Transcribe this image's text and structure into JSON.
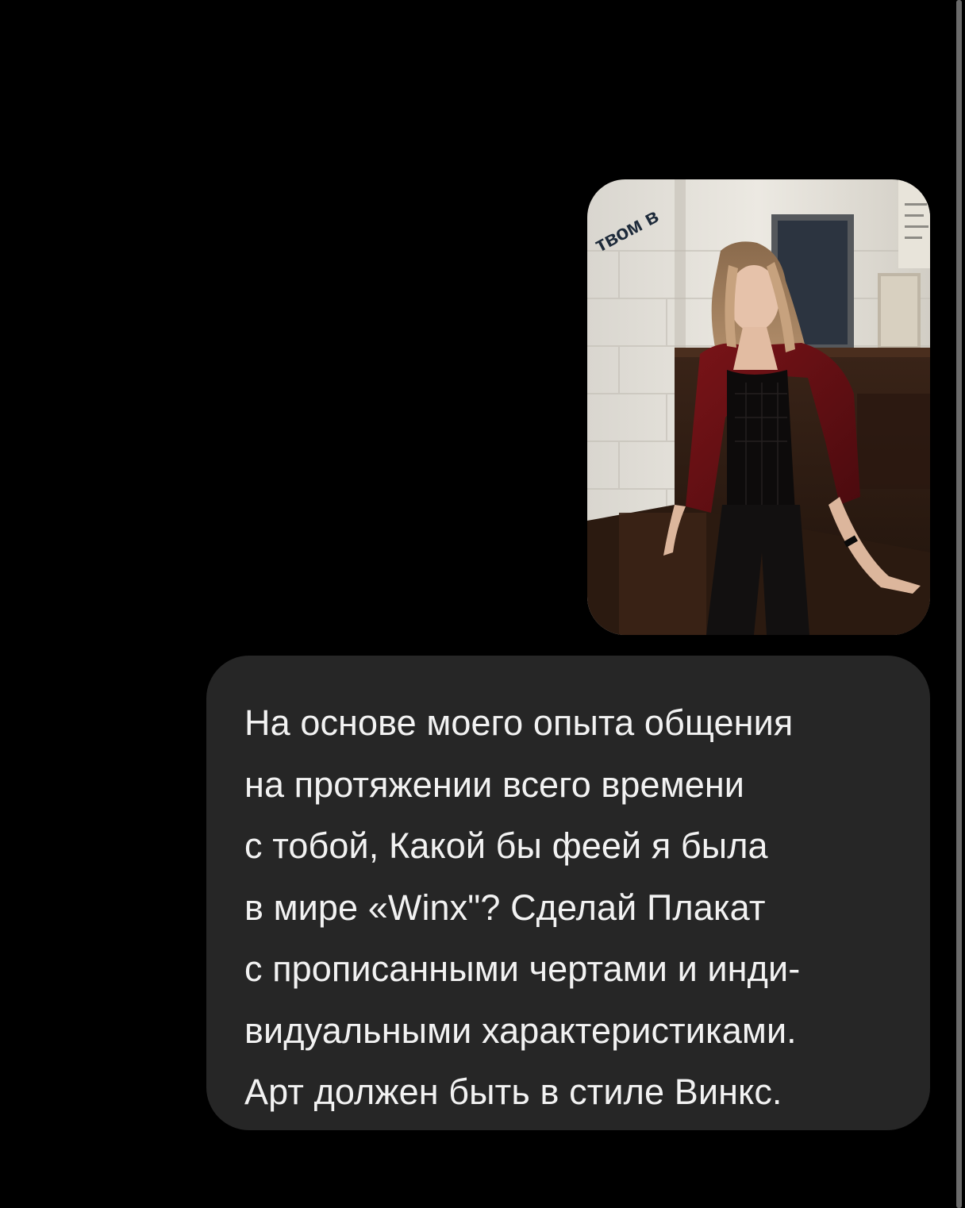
{
  "conversation": {
    "messages": [
      {
        "type": "image",
        "sender": "user",
        "sign_text": "твом в"
      },
      {
        "type": "text",
        "sender": "user",
        "text": "На основе моего опыта общения\nна протяжении всего времени\nс тобой, Какой бы феей я была\nв мире «Winx\"? Сделай Плакат\nс прописанными чертами и инди-\nвидуальными характеристиками.\nАрт должен быть в стиле Винкс."
      }
    ]
  },
  "colors": {
    "background": "#000000",
    "bubble": "#262626",
    "text": "#f2f2f2",
    "scrollbar": "#6a6a6a"
  }
}
